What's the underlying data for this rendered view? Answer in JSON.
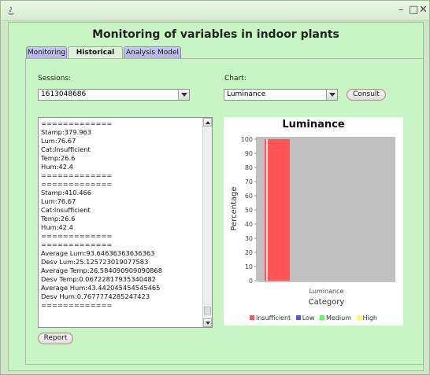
{
  "window": {
    "title": "",
    "controls": {
      "minimize": "–",
      "maximize": "□",
      "close": "✕"
    }
  },
  "app": {
    "title": "Monitoring of variables in indoor plants"
  },
  "tabs": [
    {
      "label": "Monitoring",
      "active": false
    },
    {
      "label": "Historical Data",
      "active": true
    },
    {
      "label": "Analysis Model",
      "active": false
    }
  ],
  "sessions": {
    "label": "Sessions:",
    "value": "1613048686"
  },
  "chart_select": {
    "label": "Chart:",
    "value": "Luminance"
  },
  "consult_button": "Consult",
  "report_button": "Report",
  "log_text": "=============\nStamp:379.963\nLum:76.67\nCat:Insufficient\nTemp:26.6\nHum:42.4\n=============\n=============\nStamp:410.466\nLum:76.67\nCat:Insufficient\nTemp:26.6\nHum:42.4\n=============\n=============\nAverage Lum:93.64636363636363\nDesv Lum:25.125723019077583\nAverage Temp:26.584090909090868\nDesv Temp:0.06722817935340482\nAverage Hum:43.442045454545465\nDesv Hum:0.7677774285247423\n=============",
  "colors": {
    "window_bg": "#cfe7c6",
    "panel_bg": "#c8f5c3",
    "tab_inactive": "#b4b4ea",
    "plot_bg": "#c0c0c0",
    "bar_red": "#ff5555",
    "series_low": "#5555ff",
    "series_medium": "#55ff55",
    "series_high": "#ffff55"
  },
  "chart_data": {
    "type": "bar",
    "title": "Luminance",
    "xlabel": "Category",
    "ylabel": "Percentage",
    "categories": [
      "Luminance"
    ],
    "ylim": [
      0,
      100
    ],
    "yticks": [
      0,
      10,
      20,
      30,
      40,
      50,
      60,
      70,
      80,
      90,
      100
    ],
    "grid": false,
    "legend_position": "bottom",
    "series": [
      {
        "name": "Insufficient",
        "values": [
          100
        ],
        "color": "#ff5555"
      },
      {
        "name": "Low",
        "values": [
          0
        ],
        "color": "#5555ff"
      },
      {
        "name": "Medium",
        "values": [
          0
        ],
        "color": "#55ff55"
      },
      {
        "name": "High",
        "values": [
          0
        ],
        "color": "#ffff55"
      }
    ]
  }
}
